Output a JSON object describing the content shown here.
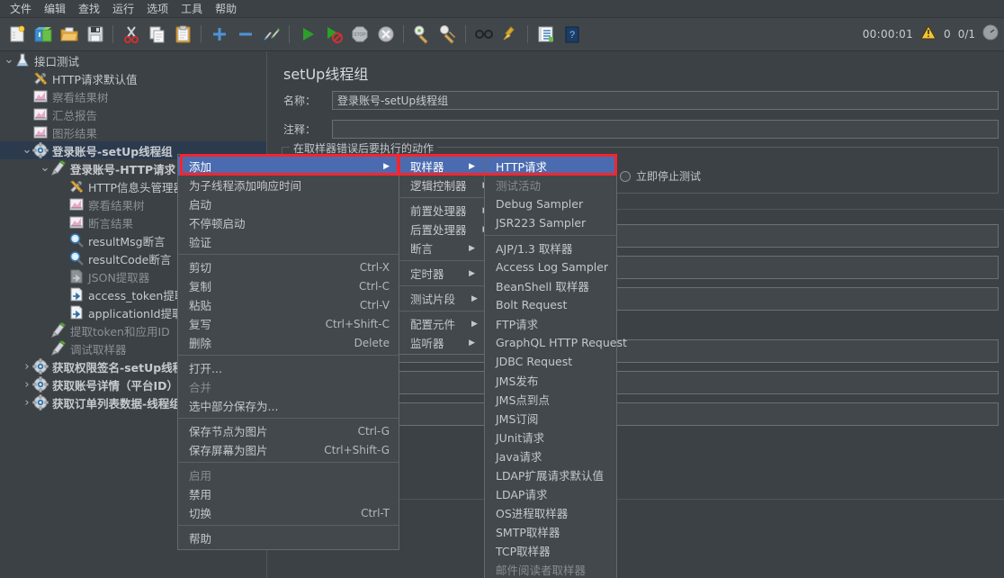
{
  "menubar": {
    "items": [
      {
        "label": "文件"
      },
      {
        "label": "编辑"
      },
      {
        "label": "查找"
      },
      {
        "label": "运行"
      },
      {
        "label": "选项"
      },
      {
        "label": "工具"
      },
      {
        "label": "帮助"
      }
    ]
  },
  "toolbar": {
    "icons": [
      "new-document-icon",
      "templates-icon",
      "open-folder-icon",
      "save-icon",
      "cut-icon",
      "copy-icon",
      "paste-icon",
      "expand-all-icon",
      "collapse-all-icon",
      "toggle-icon",
      "start-icon",
      "start-no-pause-icon",
      "stop-icon",
      "shutdown-icon",
      "clear-icon",
      "clear-all-icon",
      "search-icon",
      "search-reset-icon",
      "function-helper-icon",
      "help-icon"
    ],
    "timer": "00:00:01",
    "warning_icon": "warning-triangle-icon",
    "warning_count": "0",
    "thread_count": "0/1"
  },
  "tree": {
    "nodes": [
      {
        "label": "接口测试",
        "icon": "test-plan-icon",
        "depth": 0,
        "twisty": "down",
        "selected": false,
        "dim": false,
        "bold": false
      },
      {
        "label": "HTTP请求默认值",
        "icon": "http-defaults-icon",
        "depth": 1,
        "twisty": "",
        "selected": false,
        "dim": false,
        "bold": false
      },
      {
        "label": "察看结果树",
        "icon": "listener-icon",
        "depth": 1,
        "twisty": "",
        "selected": false,
        "dim": true,
        "bold": false
      },
      {
        "label": "汇总报告",
        "icon": "listener-icon",
        "depth": 1,
        "twisty": "",
        "selected": false,
        "dim": true,
        "bold": false
      },
      {
        "label": "图形结果",
        "icon": "listener-icon",
        "depth": 1,
        "twisty": "",
        "selected": false,
        "dim": true,
        "bold": false
      },
      {
        "label": "登录账号-setUp线程组",
        "icon": "setup-thread-group-icon",
        "depth": 1,
        "twisty": "down",
        "selected": true,
        "dim": false,
        "bold": true
      },
      {
        "label": "登录账号-HTTP请求",
        "icon": "http-sampler-icon",
        "depth": 2,
        "twisty": "down",
        "selected": false,
        "dim": false,
        "bold": true
      },
      {
        "label": "HTTP信息头管理器",
        "icon": "header-manager-icon",
        "depth": 3,
        "twisty": "",
        "selected": false,
        "dim": false,
        "bold": false
      },
      {
        "label": "察看结果树",
        "icon": "listener-icon",
        "depth": 3,
        "twisty": "",
        "selected": false,
        "dim": true,
        "bold": false
      },
      {
        "label": "断言结果",
        "icon": "listener-icon",
        "depth": 3,
        "twisty": "",
        "selected": false,
        "dim": true,
        "bold": false
      },
      {
        "label": "resultMsg断言",
        "icon": "assertion-icon",
        "depth": 3,
        "twisty": "",
        "selected": false,
        "dim": false,
        "bold": false
      },
      {
        "label": "resultCode断言",
        "icon": "assertion-icon",
        "depth": 3,
        "twisty": "",
        "selected": false,
        "dim": false,
        "bold": false
      },
      {
        "label": "JSON提取器",
        "icon": "postprocessor-disabled-icon",
        "depth": 3,
        "twisty": "",
        "selected": false,
        "dim": true,
        "bold": false
      },
      {
        "label": "access_token提取",
        "icon": "postprocessor-icon",
        "depth": 3,
        "twisty": "",
        "selected": false,
        "dim": false,
        "bold": false
      },
      {
        "label": "applicationId提取",
        "icon": "postprocessor-icon",
        "depth": 3,
        "twisty": "",
        "selected": false,
        "dim": false,
        "bold": false
      },
      {
        "label": "提取token和应用ID",
        "icon": "http-sampler-icon",
        "depth": 2,
        "twisty": "",
        "selected": false,
        "dim": true,
        "bold": false
      },
      {
        "label": "调试取样器",
        "icon": "http-sampler-icon",
        "depth": 2,
        "twisty": "",
        "selected": false,
        "dim": true,
        "bold": false
      },
      {
        "label": "获取权限签名-setUp线程组",
        "icon": "setup-thread-group-icon",
        "depth": 1,
        "twisty": "right",
        "selected": false,
        "dim": false,
        "bold": true
      },
      {
        "label": "获取账号详情（平台ID）-s",
        "icon": "setup-thread-group-icon",
        "depth": 1,
        "twisty": "right",
        "selected": false,
        "dim": false,
        "bold": true
      },
      {
        "label": "获取订单列表数据-线程组",
        "icon": "setup-thread-group-icon",
        "depth": 1,
        "twisty": "right",
        "selected": false,
        "dim": false,
        "bold": true
      }
    ]
  },
  "right_panel": {
    "title": "setUp线程组",
    "name_label": "名称：",
    "name_value": "登录账号-setUp线程组",
    "comment_label": "注释：",
    "comment_value": "",
    "action_group_title": "在取样器错误后要执行的动作",
    "action_option_label": "立即停止测试"
  },
  "context_menu": {
    "items": [
      {
        "label": "添加",
        "accel": "",
        "submenu": true,
        "highlighted": true,
        "disabled": false
      },
      {
        "label": "为子线程添加响应时间",
        "accel": "",
        "submenu": false,
        "highlighted": false,
        "disabled": false
      },
      {
        "label": "启动",
        "accel": "",
        "submenu": false,
        "highlighted": false,
        "disabled": false
      },
      {
        "label": "不停顿启动",
        "accel": "",
        "submenu": false,
        "highlighted": false,
        "disabled": false
      },
      {
        "label": "验证",
        "accel": "",
        "submenu": false,
        "highlighted": false,
        "disabled": false
      },
      {
        "separator": true
      },
      {
        "label": "剪切",
        "accel": "Ctrl-X",
        "submenu": false,
        "highlighted": false,
        "disabled": false
      },
      {
        "label": "复制",
        "accel": "Ctrl-C",
        "submenu": false,
        "highlighted": false,
        "disabled": false
      },
      {
        "label": "粘贴",
        "accel": "Ctrl-V",
        "submenu": false,
        "highlighted": false,
        "disabled": false
      },
      {
        "label": "复写",
        "accel": "Ctrl+Shift-C",
        "submenu": false,
        "highlighted": false,
        "disabled": false
      },
      {
        "label": "删除",
        "accel": "Delete",
        "submenu": false,
        "highlighted": false,
        "disabled": false
      },
      {
        "separator": true
      },
      {
        "label": "打开...",
        "accel": "",
        "submenu": false,
        "highlighted": false,
        "disabled": false
      },
      {
        "label": "合并",
        "accel": "",
        "submenu": false,
        "highlighted": false,
        "disabled": true
      },
      {
        "label": "选中部分保存为...",
        "accel": "",
        "submenu": false,
        "highlighted": false,
        "disabled": false
      },
      {
        "separator": true
      },
      {
        "label": "保存节点为图片",
        "accel": "Ctrl-G",
        "submenu": false,
        "highlighted": false,
        "disabled": false
      },
      {
        "label": "保存屏幕为图片",
        "accel": "Ctrl+Shift-G",
        "submenu": false,
        "highlighted": false,
        "disabled": false
      },
      {
        "separator": true
      },
      {
        "label": "启用",
        "accel": "",
        "submenu": false,
        "highlighted": false,
        "disabled": true
      },
      {
        "label": "禁用",
        "accel": "",
        "submenu": false,
        "highlighted": false,
        "disabled": false
      },
      {
        "label": "切换",
        "accel": "Ctrl-T",
        "submenu": false,
        "highlighted": false,
        "disabled": false
      },
      {
        "separator": true
      },
      {
        "label": "帮助",
        "accel": "",
        "submenu": false,
        "highlighted": false,
        "disabled": false
      }
    ]
  },
  "add_submenu": {
    "items": [
      {
        "label": "取样器",
        "submenu": true,
        "highlighted": true
      },
      {
        "label": "逻辑控制器",
        "submenu": true,
        "highlighted": false
      },
      {
        "separator": true
      },
      {
        "label": "前置处理器",
        "submenu": true,
        "highlighted": false
      },
      {
        "label": "后置处理器",
        "submenu": true,
        "highlighted": false
      },
      {
        "label": "断言",
        "submenu": true,
        "highlighted": false
      },
      {
        "separator": true
      },
      {
        "label": "定时器",
        "submenu": true,
        "highlighted": false
      },
      {
        "separator": true
      },
      {
        "label": "测试片段",
        "submenu": true,
        "highlighted": false
      },
      {
        "separator": true
      },
      {
        "label": "配置元件",
        "submenu": true,
        "highlighted": false
      },
      {
        "label": "监听器",
        "submenu": true,
        "highlighted": false
      }
    ]
  },
  "sampler_submenu": {
    "items": [
      {
        "label": "HTTP请求",
        "highlighted": true,
        "disabled": false
      },
      {
        "label": "测试活动",
        "highlighted": false,
        "disabled": true
      },
      {
        "label": "Debug Sampler",
        "highlighted": false,
        "disabled": false
      },
      {
        "label": "JSR223 Sampler",
        "highlighted": false,
        "disabled": false
      },
      {
        "separator": true
      },
      {
        "label": "AJP/1.3 取样器",
        "highlighted": false,
        "disabled": false
      },
      {
        "label": "Access Log Sampler",
        "highlighted": false,
        "disabled": false
      },
      {
        "label": "BeanShell 取样器",
        "highlighted": false,
        "disabled": false
      },
      {
        "label": "Bolt Request",
        "highlighted": false,
        "disabled": false
      },
      {
        "label": "FTP请求",
        "highlighted": false,
        "disabled": false
      },
      {
        "label": "GraphQL HTTP Request",
        "highlighted": false,
        "disabled": false
      },
      {
        "label": "JDBC Request",
        "highlighted": false,
        "disabled": false
      },
      {
        "label": "JMS发布",
        "highlighted": false,
        "disabled": false
      },
      {
        "label": "JMS点到点",
        "highlighted": false,
        "disabled": false
      },
      {
        "label": "JMS订阅",
        "highlighted": false,
        "disabled": false
      },
      {
        "label": "JUnit请求",
        "highlighted": false,
        "disabled": false
      },
      {
        "label": "Java请求",
        "highlighted": false,
        "disabled": false
      },
      {
        "label": "LDAP扩展请求默认值",
        "highlighted": false,
        "disabled": false
      },
      {
        "label": "LDAP请求",
        "highlighted": false,
        "disabled": false
      },
      {
        "label": "OS进程取样器",
        "highlighted": false,
        "disabled": false
      },
      {
        "label": "SMTP取样器",
        "highlighted": false,
        "disabled": false
      },
      {
        "label": "TCP取样器",
        "highlighted": false,
        "disabled": false
      },
      {
        "label": "邮件阅读者取样器",
        "highlighted": false,
        "disabled": true
      }
    ]
  },
  "colors": {
    "window_bg": "#3c4145",
    "toolbar_bg": "#41464a",
    "menu_bg": "#43484c",
    "highlight_blue": "#4a6bb0",
    "tree_selection": "#2c3a4e",
    "annotation_red": "#f5252d",
    "text": "#c4c8cc",
    "text_dim": "#878c91"
  }
}
